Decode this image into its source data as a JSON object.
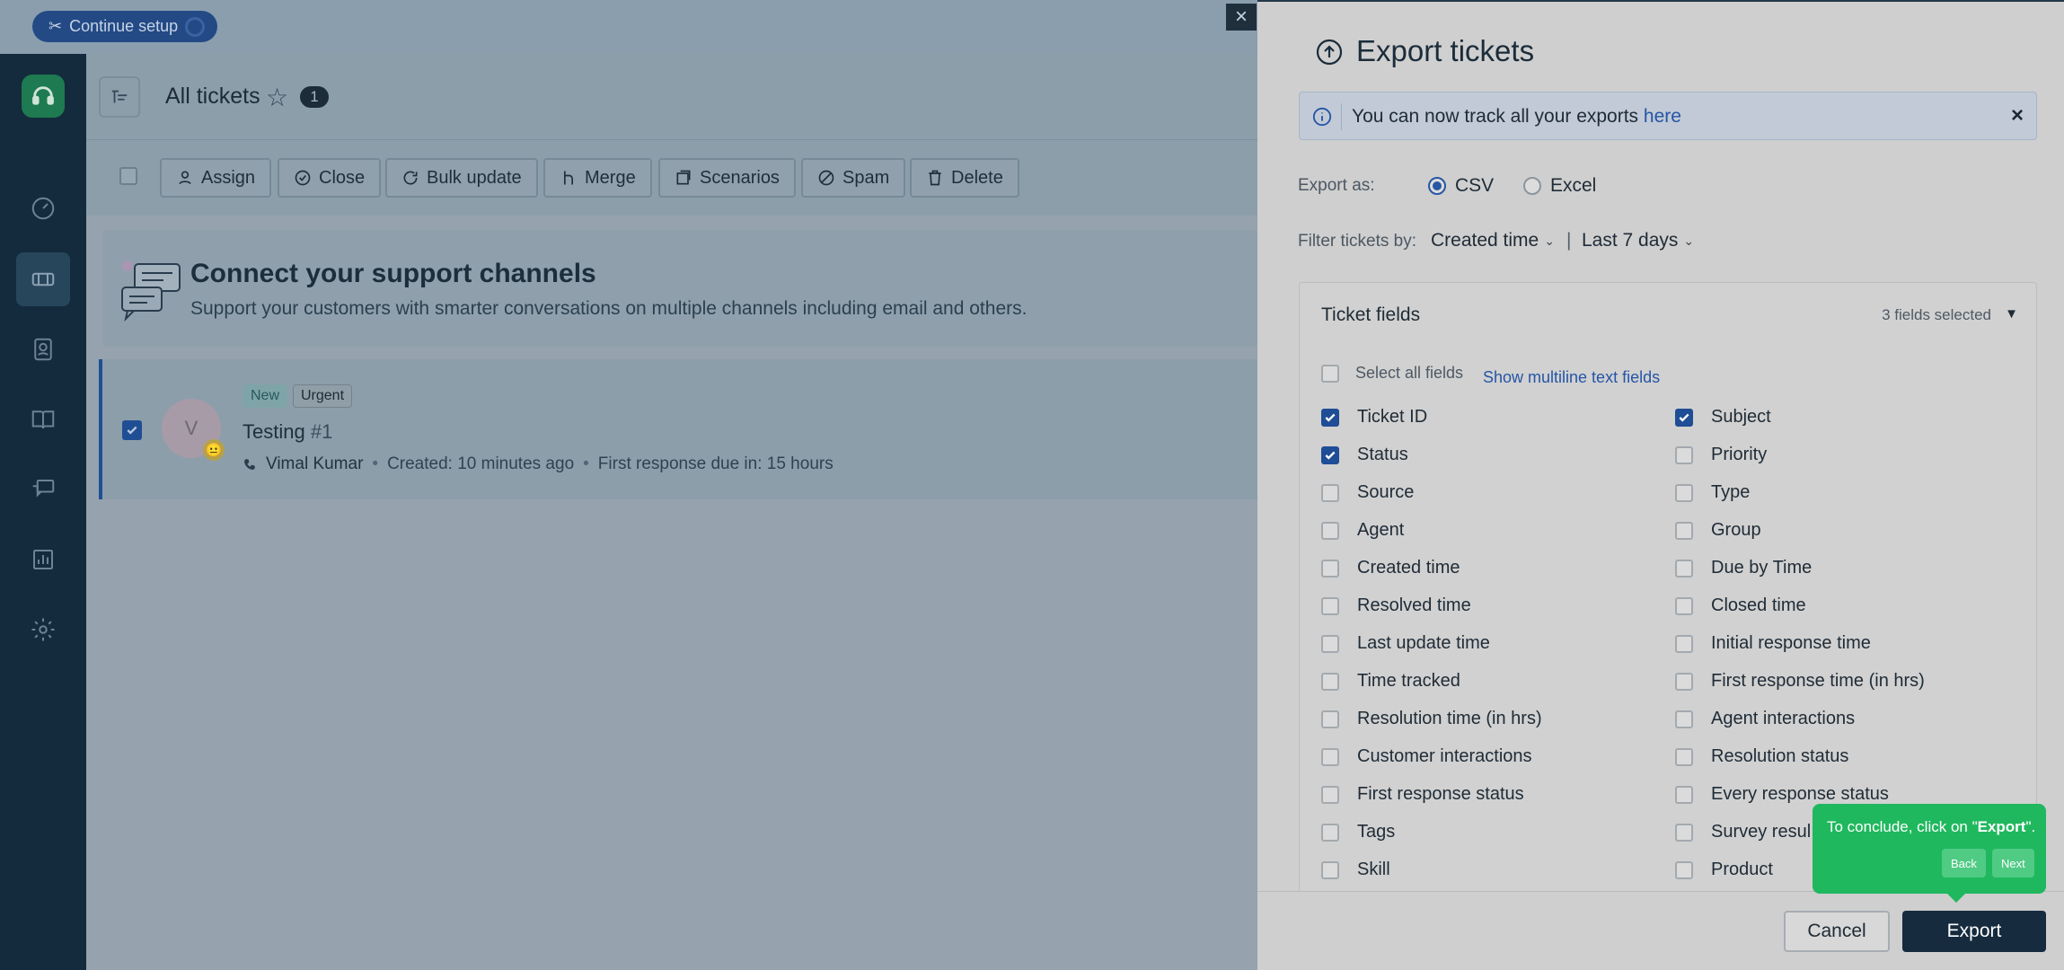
{
  "topbar": {
    "continue_setup": "Continue setup"
  },
  "header": {
    "title": "All tickets",
    "count": "1"
  },
  "bulk_actions": [
    {
      "label": "Assign",
      "icon": "user-icon"
    },
    {
      "label": "Close",
      "icon": "check-circle-icon"
    },
    {
      "label": "Bulk update",
      "icon": "refresh-icon"
    },
    {
      "label": "Merge",
      "icon": "merge-icon"
    },
    {
      "label": "Scenarios",
      "icon": "scenarios-icon"
    },
    {
      "label": "Spam",
      "icon": "spam-icon"
    },
    {
      "label": "Delete",
      "icon": "trash-icon"
    }
  ],
  "banner": {
    "title": "Connect your support channels",
    "subtitle": "Support your customers with smarter conversations on multiple channels including email and others."
  },
  "ticket": {
    "tag_new": "New",
    "tag_urgent": "Urgent",
    "title": "Testing",
    "number": "#1",
    "avatar": "V",
    "agent": "Vimal Kumar",
    "created": "Created: 10 minutes ago",
    "first_response": "First response due in: 15 hours",
    "bullet": "•"
  },
  "panel": {
    "title": "Export tickets",
    "close_symbol": "×",
    "info_text": "You can now track all your exports ",
    "info_link": "here",
    "info_close": "×",
    "export_as_label": "Export as:",
    "formats": [
      {
        "label": "CSV",
        "selected": true
      },
      {
        "label": "Excel",
        "selected": false
      }
    ],
    "filter_label": "Filter tickets by:",
    "filter_field": "Created time",
    "filter_separator": "|",
    "filter_range": "Last 7 days",
    "fields_title": "Ticket fields",
    "fields_count": "3 fields selected",
    "select_all": "Select all fields",
    "show_multiline": "Show multiline text fields",
    "fields_left": [
      {
        "label": "Ticket ID",
        "checked": true
      },
      {
        "label": "Status",
        "checked": true
      },
      {
        "label": "Source",
        "checked": false
      },
      {
        "label": "Agent",
        "checked": false
      },
      {
        "label": "Created time",
        "checked": false
      },
      {
        "label": "Resolved time",
        "checked": false
      },
      {
        "label": "Last update time",
        "checked": false
      },
      {
        "label": "Time tracked",
        "checked": false
      },
      {
        "label": "Resolution time (in hrs)",
        "checked": false
      },
      {
        "label": "Customer interactions",
        "checked": false
      },
      {
        "label": "First response status",
        "checked": false
      },
      {
        "label": "Tags",
        "checked": false
      },
      {
        "label": "Skill",
        "checked": false
      }
    ],
    "fields_right": [
      {
        "label": "Subject",
        "checked": true
      },
      {
        "label": "Priority",
        "checked": false
      },
      {
        "label": "Type",
        "checked": false
      },
      {
        "label": "Group",
        "checked": false
      },
      {
        "label": "Due by Time",
        "checked": false
      },
      {
        "label": "Closed time",
        "checked": false
      },
      {
        "label": "Initial response time",
        "checked": false
      },
      {
        "label": "First response time (in hrs)",
        "checked": false
      },
      {
        "label": "Agent interactions",
        "checked": false
      },
      {
        "label": "Resolution status",
        "checked": false
      },
      {
        "label": "Every response status",
        "checked": false
      },
      {
        "label": "Survey resul",
        "checked": false
      },
      {
        "label": "Product",
        "checked": false
      }
    ],
    "cancel": "Cancel",
    "export": "Export"
  },
  "tooltip": {
    "text_before": "To conclude, click on \"",
    "text_bold": "Export",
    "text_after": "\".",
    "back": "Back",
    "next": "Next"
  }
}
